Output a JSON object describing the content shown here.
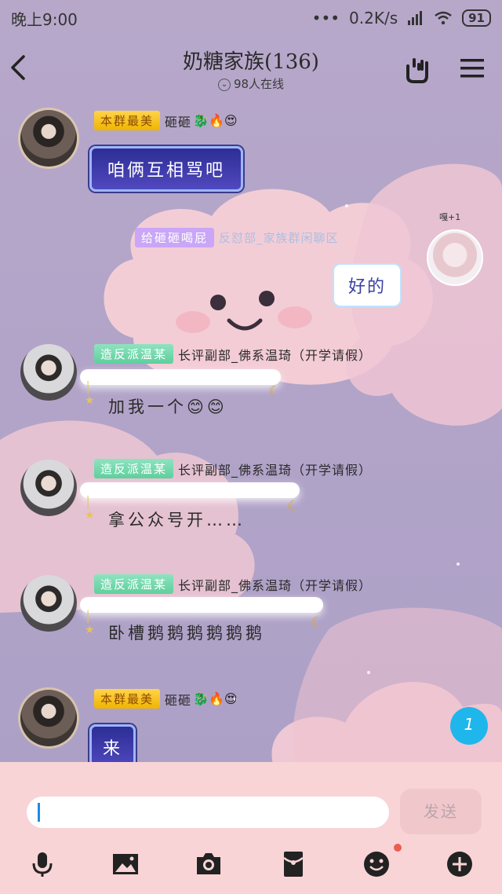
{
  "status_bar": {
    "time": "晚上9:00",
    "dots": "•••",
    "speed": "0.2K/s",
    "battery": "91"
  },
  "header": {
    "title": "奶糖家族(136)",
    "online": "98人在线"
  },
  "messages": [
    {
      "tag": "本群最美",
      "name": "砸砸",
      "emojis": "🐉🔥😍",
      "text": "咱俩互相骂吧"
    },
    {
      "tag": "给砸砸喝屁",
      "faint_name": "反怼部_家族群闲聊区",
      "text": "好的",
      "badge": "嘎+1"
    },
    {
      "tag": "造反派温某",
      "name": "长评副部_佛系温琦（开学请假）",
      "text": "加我一个😊😊"
    },
    {
      "tag": "造反派温某",
      "name": "长评副部_佛系温琦（开学请假）",
      "text": "拿公众号开……"
    },
    {
      "tag": "造反派温某",
      "name": "长评副部_佛系温琦（开学请假）",
      "text": "卧槽鹅鹅鹅鹅鹅鹅"
    },
    {
      "tag": "本群最美",
      "name": "砸砸",
      "emojis": "🐉🔥😍",
      "text": "来"
    }
  ],
  "unread_count": "1",
  "input": {
    "value": "",
    "send_label": "发送"
  },
  "toolbar": [
    "microphone-icon",
    "image-icon",
    "camera-icon",
    "red-packet-icon",
    "emoji-icon",
    "plus-icon"
  ],
  "colors": {
    "accent": "#1fb6ec",
    "input_bg": "#f8d4d6"
  }
}
